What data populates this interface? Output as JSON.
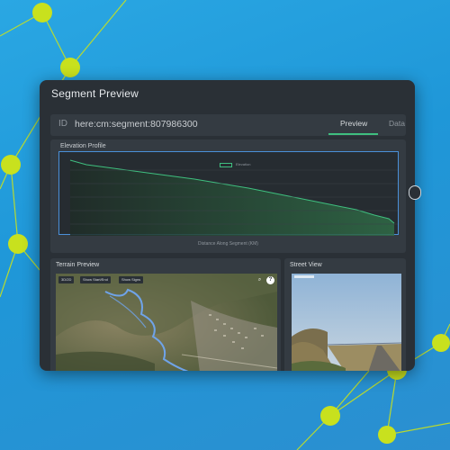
{
  "window": {
    "title": "Segment Preview"
  },
  "segment": {
    "id_label": "ID",
    "id_value": "here:cm:segment:807986300"
  },
  "tabs": [
    {
      "label": "Preview",
      "active": true
    },
    {
      "label": "Data",
      "active": false
    }
  ],
  "elevation": {
    "title": "Elevation Profile",
    "legend": "Elevation",
    "xlabel": "Distance Along Segment (KM)"
  },
  "terrain": {
    "title": "Terrain Preview",
    "buttons": [
      "3D/2D",
      "Show Start/End",
      "Show Signs"
    ],
    "icons": [
      "search-icon",
      "help-icon"
    ]
  },
  "street": {
    "title": "Street View"
  },
  "colors": {
    "accent": "#3fbf7f",
    "plot_border": "#4a90d9",
    "panel": "#2a3036",
    "card": "#343b42"
  }
}
